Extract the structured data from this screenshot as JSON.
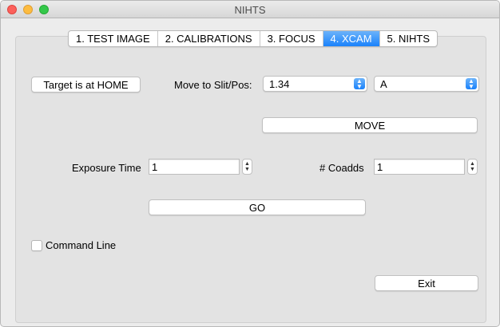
{
  "window": {
    "title": "NIHTS"
  },
  "tabs": [
    {
      "label": "1. TEST IMAGE",
      "active": false
    },
    {
      "label": "2. CALIBRATIONS",
      "active": false
    },
    {
      "label": "3. FOCUS",
      "active": false
    },
    {
      "label": "4. XCAM",
      "active": true
    },
    {
      "label": "5. NIHTS",
      "active": false
    }
  ],
  "target": {
    "button_label": "Target is at HOME"
  },
  "move": {
    "label": "Move to Slit/Pos:",
    "slit_value": "1.34",
    "pos_value": "A",
    "button_label": "MOVE"
  },
  "exposure": {
    "label": "Exposure Time",
    "value": "1"
  },
  "coadds": {
    "label": "# Coadds",
    "value": "1"
  },
  "go": {
    "button_label": "GO"
  },
  "command_line": {
    "label": "Command Line",
    "checked": false
  },
  "exit": {
    "button_label": "Exit"
  },
  "colors": {
    "accent": "#1a82fb",
    "background": "#ececec"
  }
}
